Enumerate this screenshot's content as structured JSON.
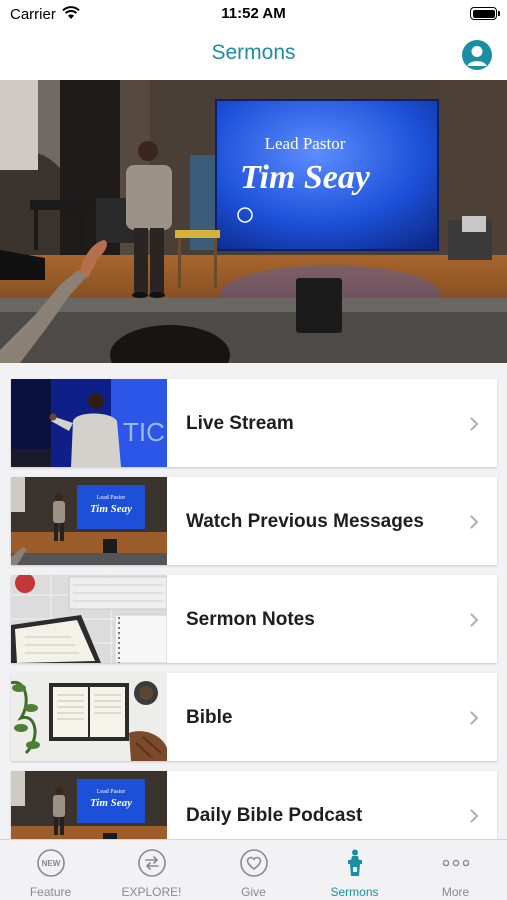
{
  "status_bar": {
    "carrier": "Carrier",
    "time": "11:52 AM"
  },
  "nav": {
    "title": "Sermons"
  },
  "hero": {
    "screen_line1": "Lead Pastor",
    "screen_line2": "Tim Seay"
  },
  "list": {
    "items": [
      {
        "label": "Live Stream"
      },
      {
        "label": "Watch Previous Messages",
        "thumb_line1": "Lead Pastor",
        "thumb_line2": "Tim Seay"
      },
      {
        "label": "Sermon Notes"
      },
      {
        "label": "Bible"
      },
      {
        "label": "Daily Bible Podcast",
        "thumb_line1": "Lead Pastor",
        "thumb_line2": "Tim Seay"
      }
    ]
  },
  "tabs": [
    {
      "label": "Feature",
      "icon": "new-badge-icon",
      "badge": "NEW"
    },
    {
      "label": "EXPLORE!",
      "icon": "swap-arrows-icon"
    },
    {
      "label": "Give",
      "icon": "heart-icon"
    },
    {
      "label": "Sermons",
      "icon": "pulpit-icon",
      "active": true
    },
    {
      "label": "More",
      "icon": "more-dots-icon"
    }
  ],
  "colors": {
    "accent": "#1b8ea3",
    "inactive": "#8a8a8e",
    "screen_blue": "#1c50d8"
  }
}
